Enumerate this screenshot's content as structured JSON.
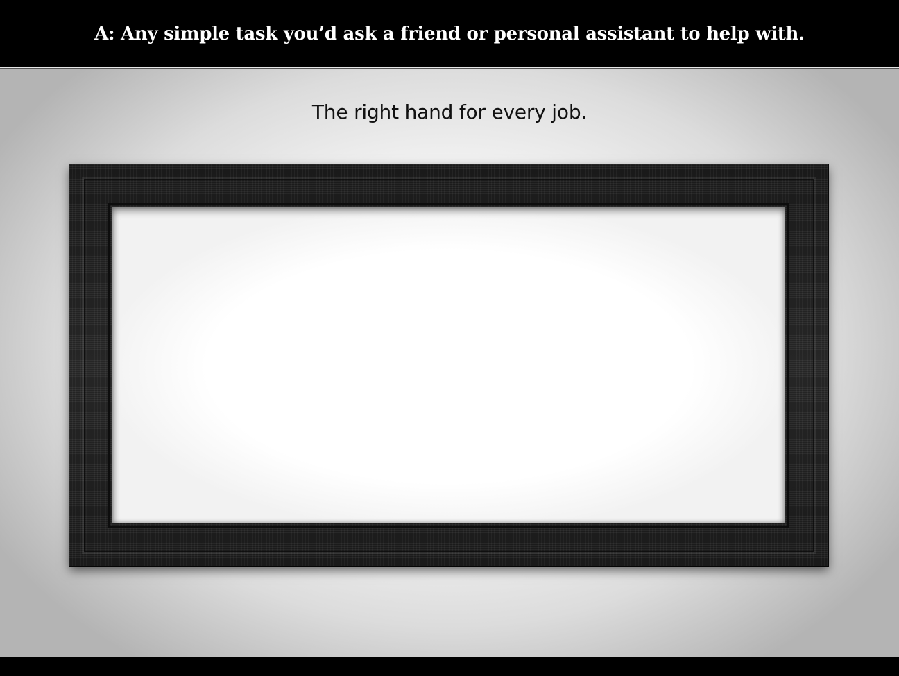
{
  "banner": {
    "text": "A: Any simple task you’d ask a friend or personal assistant to help with."
  },
  "subtitle": "The right hand for every job.",
  "frame": {
    "icon": "picture-frame-icon"
  },
  "colors": {
    "banner_background": "#000000",
    "banner_text": "#ffffff",
    "frame_wood": "#1f1f1f",
    "canvas": "#ffffff"
  }
}
